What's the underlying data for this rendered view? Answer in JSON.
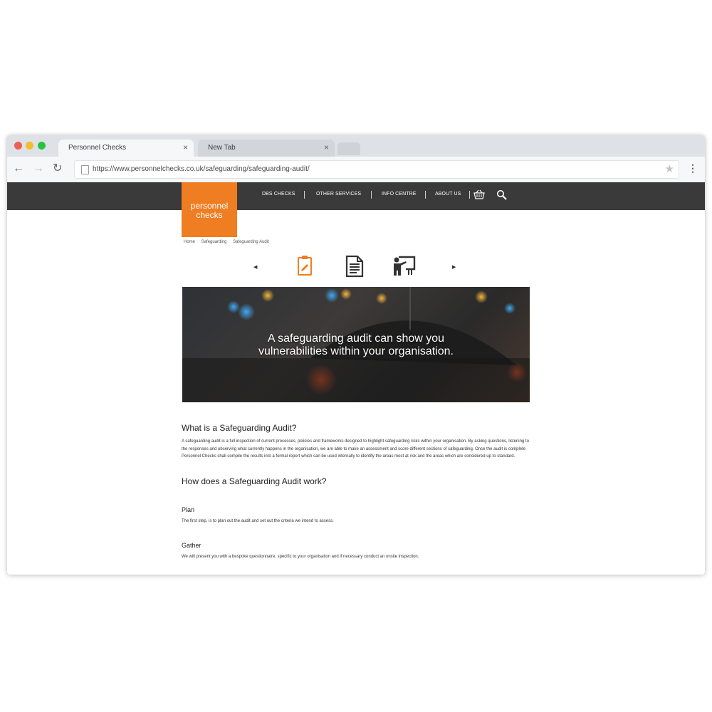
{
  "browser": {
    "tabs": [
      {
        "label": "Personnel Checks",
        "close": "×"
      },
      {
        "label": "New Tab",
        "close": "×"
      }
    ],
    "url": "https://www.personnelchecks.co.uk/safeguarding/safeguarding-audit/",
    "icons": {
      "back": "arrow-left-icon",
      "forward": "arrow-right-icon",
      "reload": "reload-icon",
      "star": "star-icon",
      "menu": "kebab-menu-icon"
    }
  },
  "site": {
    "logo": {
      "line1": "personnel",
      "line2": "checks",
      "color": "#ef7d22"
    },
    "nav_bg": "#3a3a3a",
    "menu": [
      "DBS CHECKS",
      "OTHER SERVICES",
      "INFO CENTRE",
      "ABOUT US"
    ],
    "breadcrumb": [
      "Home",
      "Safeguarding",
      "Safeguarding Audit"
    ],
    "carousel_icons": [
      "clipboard-icon",
      "document-icon",
      "presentation-icon"
    ],
    "active_carousel_index": 0,
    "hero": {
      "line1": "A safeguarding audit can show you",
      "line2": "vulnerabilities within your organisation."
    },
    "sections": {
      "what_title": "What is a Safeguarding Audit?",
      "what_body": "A safeguarding audit is a full inspection of current processes, policies and frameworks designed to highlight safeguarding risks within your organisation. By asking questions, listening to the responses and observing what currently happens in the organisation, we are able to make an assessment and score different sections of safeguarding. Once the audit is complete Personnel Checks shall compile the results into a formal report which can be used internally to identify the areas most at risk and the areas which are considered up to standard.",
      "how_title": "How does a Safeguarding Audit work?",
      "plan_title": "Plan",
      "plan_body": "The first step, is to plan out the audit and set out the criteria we intend to assess.",
      "gather_title": "Gather",
      "gather_body": "We will present you with a bespoke questionnaire, specific to your organisation and if necessary conduct an onsite inspection."
    }
  }
}
